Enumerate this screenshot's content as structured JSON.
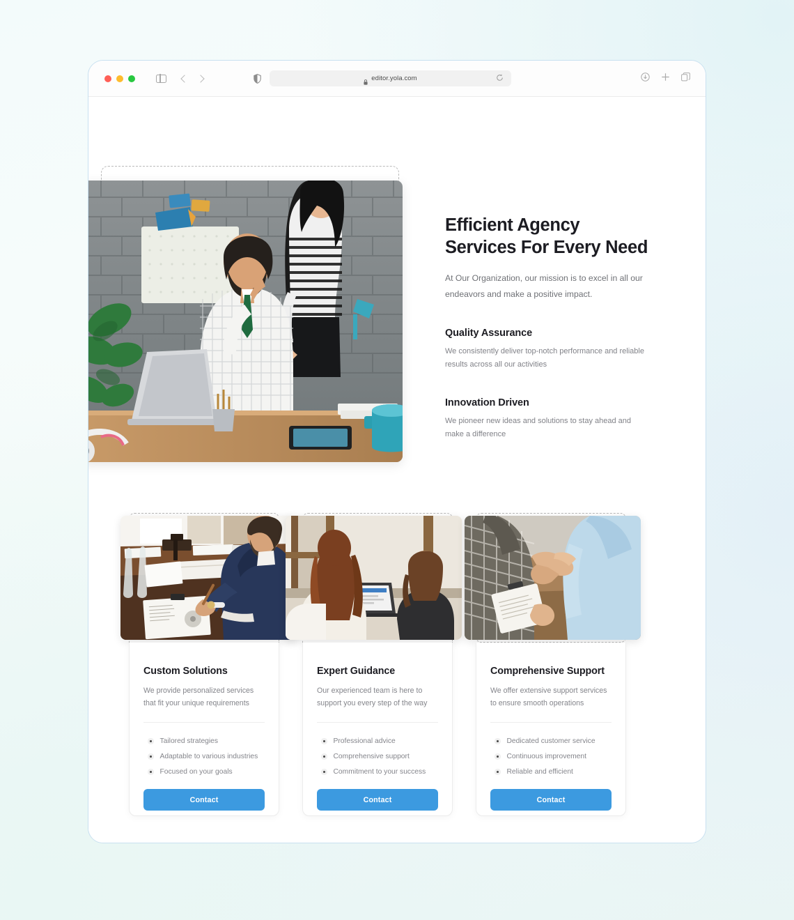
{
  "browser": {
    "url": "editor.yola.com",
    "traffic_lights": [
      "close-red",
      "minimize-yellow",
      "maximize-green"
    ],
    "icons": {
      "sidebar": "sidebar-toggle-icon",
      "back": "back-chevron-icon",
      "forward": "forward-chevron-icon",
      "shield": "privacy-shield-icon",
      "lock": "lock-icon",
      "reload": "reload-icon",
      "downloads": "downloads-icon",
      "new_tab": "new-tab-plus-icon",
      "tab_overview": "tab-overview-icon"
    }
  },
  "hero": {
    "image_alt": "team-meeting-photo",
    "heading_line1": "Efficient Agency",
    "heading_line2": "Services For Every Need",
    "lead": "At Our Organization, our mission is to excel in all our endeavors and make a positive impact.",
    "features": [
      {
        "title": "Quality Assurance",
        "text": "We consistently deliver top-notch performance and reliable results across all our activities"
      },
      {
        "title": "Innovation Driven",
        "text": "We pioneer new ideas and solutions to stay ahead and make a difference"
      }
    ]
  },
  "colors": {
    "accent": "#3c9ae0",
    "heading": "#1c1c22",
    "body_text": "#84858b",
    "frame_border": "#c8e0f0"
  },
  "cards": [
    {
      "image_alt": "businessman-signing-documents-photo",
      "title": "Custom Solutions",
      "desc": "We provide personalized services that fit your unique requirements",
      "bullets": [
        "Tailored strategies",
        "Adaptable to various industries",
        "Focused on your goals"
      ],
      "cta": "Contact"
    },
    {
      "image_alt": "two-women-at-laptop-photo",
      "title": "Expert Guidance",
      "desc": "Our experienced team is here to support you every step of the way",
      "bullets": [
        "Professional advice",
        "Comprehensive support",
        "Commitment to your success"
      ],
      "cta": "Contact"
    },
    {
      "image_alt": "handshake-with-clipboard-photo",
      "title": "Comprehensive Support",
      "desc": "We offer extensive support services to ensure smooth operations",
      "bullets": [
        "Dedicated customer service",
        "Continuous improvement",
        "Reliable and efficient"
      ],
      "cta": "Contact"
    }
  ]
}
